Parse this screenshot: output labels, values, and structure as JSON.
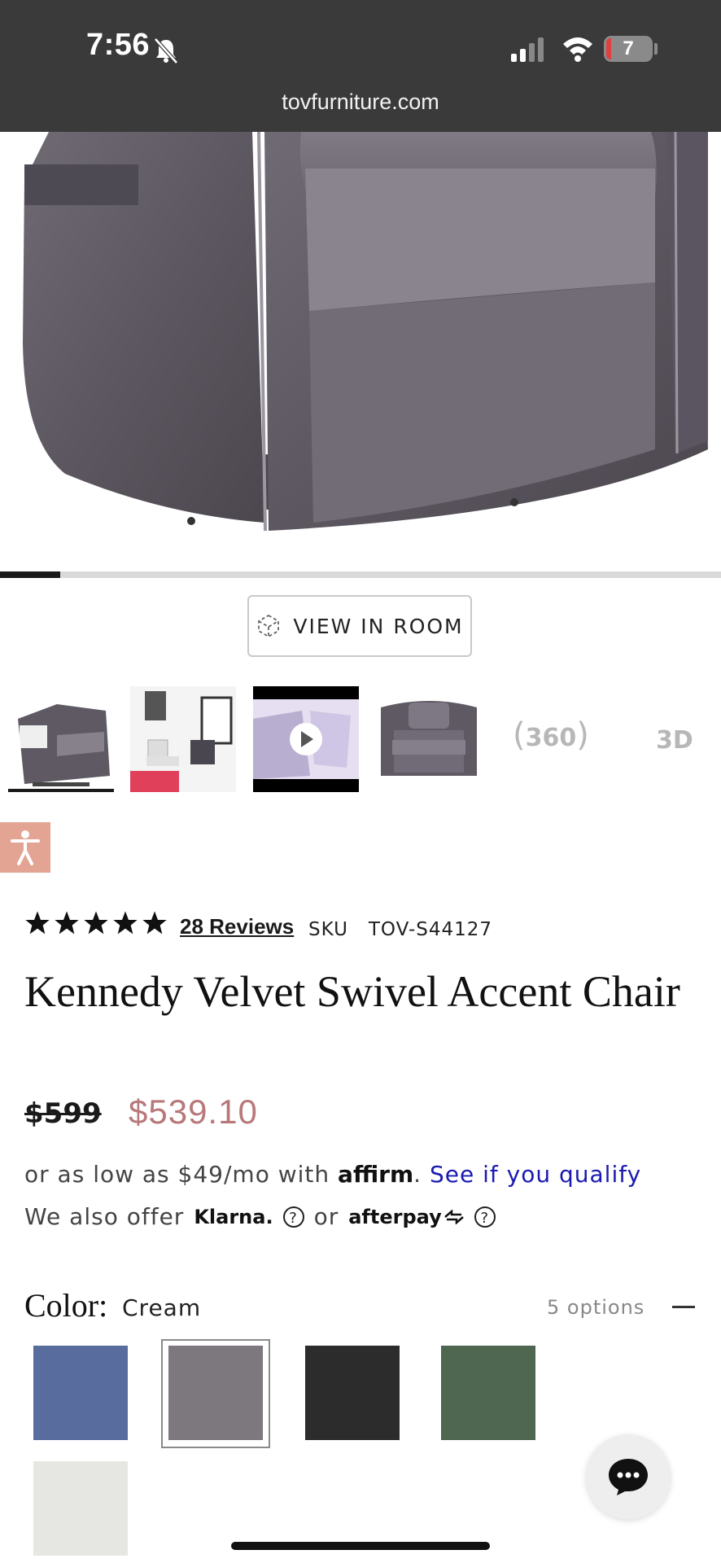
{
  "status_bar": {
    "time": "7:56",
    "battery": "7",
    "url": "tovfurniture.com"
  },
  "gallery": {
    "view_in_room_label": "VIEW IN ROOM",
    "label_360": "360",
    "label_3d": "3D"
  },
  "product": {
    "review_link": "28 Reviews",
    "sku_label": "SKU",
    "sku_value": "TOV-S44127",
    "title": "Kennedy Velvet Swivel Accent Chair",
    "price_old": "$599",
    "price_new": "$539.10",
    "rating_stars": 5
  },
  "financing": {
    "line1_prefix": "or as low as $49/mo with",
    "affirm_brand": "affirm",
    "qualify_link": "See if you qualify",
    "line2_prefix": "We also offer",
    "klarna_brand": "Klarna.",
    "or_text": "or",
    "afterpay_brand": "afterpay"
  },
  "color": {
    "label": "Color:",
    "selected": "Cream",
    "options_count": "5 options",
    "swatches": [
      "#586d9e",
      "#7c787d",
      "#2c2c2d",
      "#4f6650",
      "#e6e6e2"
    ]
  }
}
